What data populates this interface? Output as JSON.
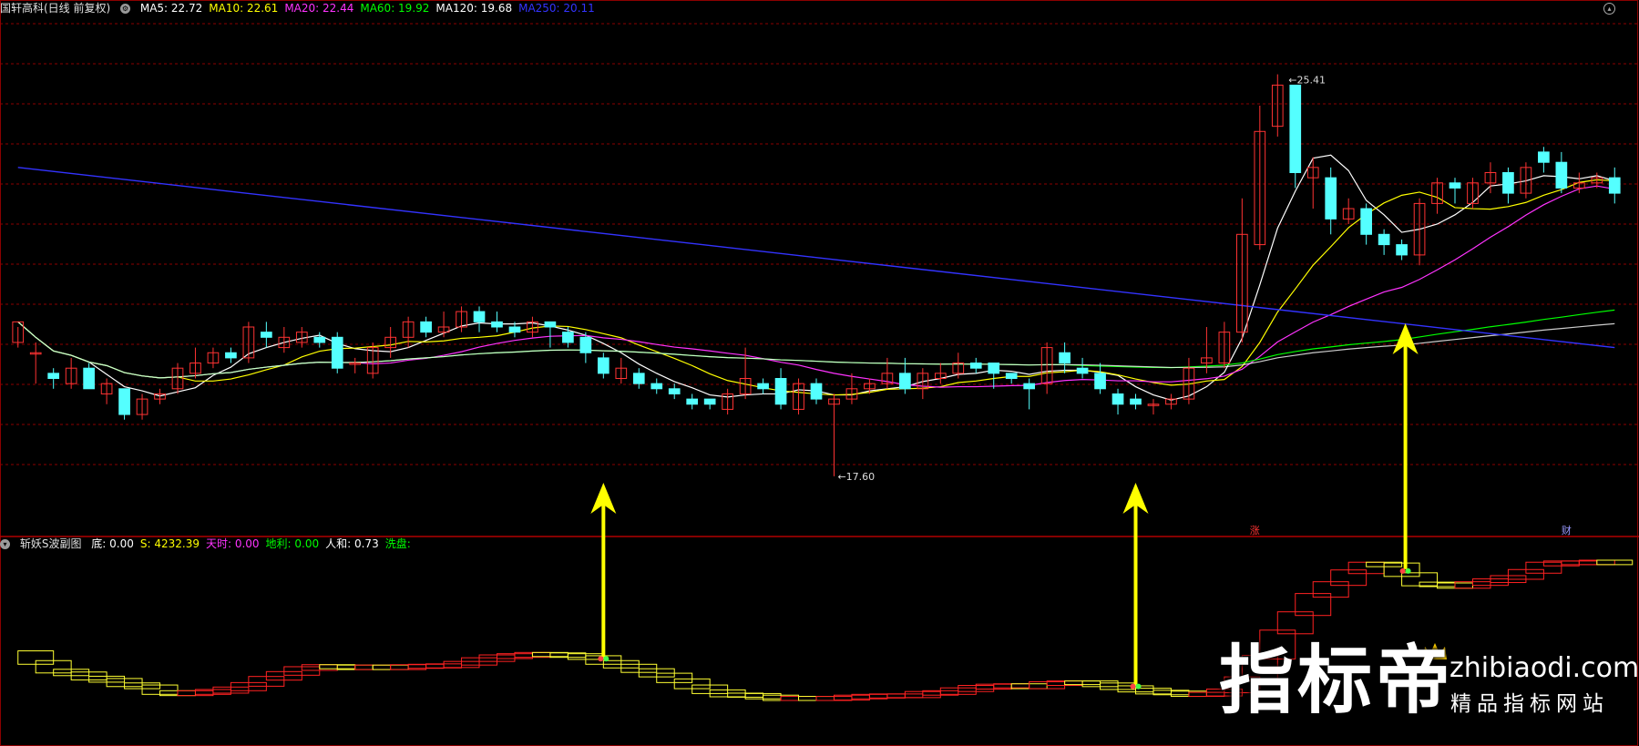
{
  "header": {
    "stock_title": "国轩高科(日线 前复权)",
    "ma_labels": [
      {
        "text": "MA5: 22.72",
        "color": "#ffffff"
      },
      {
        "text": "MA10: 22.61",
        "color": "#ffff00"
      },
      {
        "text": "MA20: 22.44",
        "color": "#ff33ff"
      },
      {
        "text": "MA60: 19.92",
        "color": "#00ff00"
      },
      {
        "text": "MA120: 19.68",
        "color": "#ffffff"
      },
      {
        "text": "MA250: 20.11",
        "color": "#3333ff"
      }
    ]
  },
  "sub_header": {
    "indicator_name": "斩妖S波副图",
    "values": [
      {
        "text": "底: 0.00",
        "color": "#ffffff"
      },
      {
        "text": "S: 4232.39",
        "color": "#ffff00"
      },
      {
        "text": "天时: 0.00",
        "color": "#ff33ff"
      },
      {
        "text": "地利: 0.00",
        "color": "#00ff00"
      },
      {
        "text": "人和: 0.73",
        "color": "#ffffff"
      },
      {
        "text": "洗盘:",
        "color": "#00ff00"
      }
    ]
  },
  "markers": {
    "zhang": "涨",
    "cai": "财"
  },
  "watermark": {
    "brand": "指标帝",
    "site": "zhibiaodi.com",
    "slogan": "精品指标网站"
  },
  "colors": {
    "up": "#ff3333",
    "down": "#54ffff",
    "grid": "#8b0000",
    "arrow": "#ffff00"
  },
  "chart_data": {
    "type": "candlestick",
    "price_range": [
      16.5,
      26.5
    ],
    "high_label": "25.41",
    "low_label": "17.60",
    "candles": [
      [
        20.2,
        20.6,
        20.5,
        20.1
      ],
      [
        20.0,
        20.0,
        20.2,
        19.4
      ],
      [
        19.6,
        19.5,
        19.7,
        19.3
      ],
      [
        19.4,
        19.7,
        19.9,
        19.3
      ],
      [
        19.7,
        19.3,
        19.8,
        19.3
      ],
      [
        19.2,
        19.4,
        19.5,
        19.0
      ],
      [
        19.3,
        18.8,
        19.3,
        18.7
      ],
      [
        18.8,
        19.1,
        19.2,
        18.7
      ],
      [
        19.1,
        19.2,
        19.3,
        19.0
      ],
      [
        19.3,
        19.7,
        19.8,
        19.2
      ],
      [
        19.6,
        19.8,
        20.1,
        19.5
      ],
      [
        19.8,
        20.0,
        20.1,
        19.7
      ],
      [
        20.0,
        19.9,
        20.1,
        19.8
      ],
      [
        19.9,
        20.5,
        20.6,
        19.8
      ],
      [
        20.4,
        20.3,
        20.6,
        20.1
      ],
      [
        20.1,
        20.3,
        20.5,
        20.0
      ],
      [
        20.2,
        20.4,
        20.5,
        20.1
      ],
      [
        20.3,
        20.2,
        20.4,
        20.1
      ],
      [
        20.3,
        19.7,
        20.4,
        19.6
      ],
      [
        19.8,
        19.8,
        19.9,
        19.6
      ],
      [
        19.6,
        20.1,
        20.2,
        19.5
      ],
      [
        20.1,
        20.3,
        20.5,
        19.9
      ],
      [
        20.3,
        20.6,
        20.7,
        20.1
      ],
      [
        20.6,
        20.4,
        20.7,
        20.3
      ],
      [
        20.4,
        20.5,
        20.8,
        20.3
      ],
      [
        20.5,
        20.8,
        20.9,
        20.4
      ],
      [
        20.8,
        20.6,
        20.9,
        20.4
      ],
      [
        20.6,
        20.5,
        20.8,
        20.4
      ],
      [
        20.5,
        20.4,
        20.6,
        20.3
      ],
      [
        20.4,
        20.6,
        20.7,
        20.3
      ],
      [
        20.6,
        20.5,
        20.6,
        20.1
      ],
      [
        20.4,
        20.2,
        20.5,
        20.1
      ],
      [
        20.3,
        20.0,
        20.4,
        19.8
      ],
      [
        19.9,
        19.6,
        20.0,
        19.5
      ],
      [
        19.5,
        19.7,
        19.9,
        19.4
      ],
      [
        19.6,
        19.4,
        19.7,
        19.3
      ],
      [
        19.4,
        19.3,
        19.5,
        19.2
      ],
      [
        19.3,
        19.2,
        19.4,
        19.1
      ],
      [
        19.1,
        19.0,
        19.2,
        18.9
      ],
      [
        19.1,
        19.0,
        19.1,
        18.9
      ],
      [
        18.9,
        19.2,
        19.3,
        18.8
      ],
      [
        19.2,
        19.5,
        20.1,
        19.1
      ],
      [
        19.4,
        19.3,
        19.5,
        19.2
      ],
      [
        19.5,
        19.0,
        19.7,
        18.9
      ],
      [
        18.9,
        19.4,
        19.5,
        18.8
      ],
      [
        19.4,
        19.1,
        19.5,
        19.0
      ],
      [
        19.0,
        19.1,
        19.2,
        17.6
      ],
      [
        19.1,
        19.3,
        19.6,
        19.0
      ],
      [
        19.3,
        19.4,
        19.5,
        19.2
      ],
      [
        19.4,
        19.6,
        19.9,
        19.3
      ],
      [
        19.6,
        19.3,
        19.9,
        19.2
      ],
      [
        19.3,
        19.6,
        19.7,
        19.1
      ],
      [
        19.5,
        19.6,
        19.8,
        19.4
      ],
      [
        19.6,
        19.8,
        20.0,
        19.5
      ],
      [
        19.8,
        19.7,
        19.9,
        19.6
      ],
      [
        19.8,
        19.6,
        19.8,
        19.3
      ],
      [
        19.6,
        19.5,
        19.6,
        19.4
      ],
      [
        19.4,
        19.3,
        19.5,
        18.9
      ],
      [
        19.4,
        20.1,
        20.2,
        19.2
      ],
      [
        20.0,
        19.8,
        20.2,
        19.6
      ],
      [
        19.7,
        19.6,
        19.9,
        19.5
      ],
      [
        19.6,
        19.3,
        19.8,
        19.2
      ],
      [
        19.2,
        19.0,
        19.3,
        18.8
      ],
      [
        19.1,
        19.0,
        19.2,
        18.9
      ],
      [
        19.0,
        19.0,
        19.1,
        18.8
      ],
      [
        19.0,
        19.1,
        19.2,
        18.9
      ],
      [
        19.1,
        19.7,
        19.9,
        19.0
      ],
      [
        19.8,
        19.9,
        20.5,
        19.6
      ],
      [
        19.8,
        20.4,
        20.6,
        19.7
      ],
      [
        20.4,
        22.3,
        23.0,
        20.2
      ],
      [
        22.1,
        24.3,
        24.8,
        22.0
      ],
      [
        24.4,
        25.2,
        25.41,
        24.2
      ],
      [
        25.2,
        23.5,
        23.8,
        23.2
      ],
      [
        23.4,
        23.6,
        23.8,
        22.8
      ],
      [
        23.4,
        22.6,
        23.6,
        22.3
      ],
      [
        22.6,
        22.8,
        23.0,
        22.5
      ],
      [
        22.8,
        22.3,
        22.9,
        22.1
      ],
      [
        22.3,
        22.1,
        22.4,
        21.9
      ],
      [
        22.1,
        21.9,
        22.2,
        21.8
      ],
      [
        21.9,
        22.9,
        23.0,
        21.7
      ],
      [
        22.9,
        23.3,
        23.4,
        22.7
      ],
      [
        23.3,
        23.2,
        23.4,
        22.9
      ],
      [
        22.9,
        23.3,
        23.4,
        22.8
      ],
      [
        23.3,
        23.5,
        23.7,
        23.1
      ],
      [
        23.5,
        23.1,
        23.6,
        22.9
      ],
      [
        23.1,
        23.6,
        23.7,
        23.0
      ],
      [
        23.9,
        23.7,
        24.0,
        23.5
      ],
      [
        23.7,
        23.2,
        23.9,
        23.1
      ],
      [
        23.2,
        23.3,
        23.5,
        23.1
      ],
      [
        23.3,
        23.4,
        23.5,
        23.2
      ],
      [
        23.4,
        23.1,
        23.6,
        22.9
      ]
    ]
  }
}
